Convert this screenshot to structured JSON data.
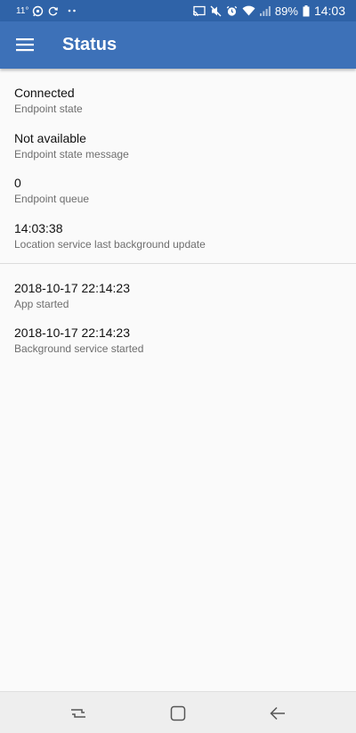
{
  "status_bar": {
    "temperature": "11°",
    "battery_percent": "89%",
    "time": "14:03",
    "icons_left": [
      "whatsapp-icon",
      "sync-icon",
      "more-dots-icon"
    ],
    "icons_right": [
      "cast-icon",
      "mute-icon",
      "alarm-icon",
      "wifi-icon",
      "signal-icon",
      "battery-icon"
    ]
  },
  "app_bar": {
    "title": "Status",
    "menu_icon": "hamburger-menu-icon"
  },
  "status_items": [
    {
      "value": "Connected",
      "label": "Endpoint state"
    },
    {
      "value": "Not available",
      "label": "Endpoint state message"
    },
    {
      "value": "0",
      "label": "Endpoint queue"
    },
    {
      "value": "14:03:38",
      "label": "Location service last background update"
    }
  ],
  "app_items": [
    {
      "value": "2018-10-17 22:14:23",
      "label": "App started"
    },
    {
      "value": "2018-10-17 22:14:23",
      "label": "Background service started"
    }
  ],
  "nav_bar": {
    "buttons": [
      "recents-icon",
      "home-icon",
      "back-icon"
    ]
  },
  "colors": {
    "status_bar": "#2f63a8",
    "app_bar": "#3d71b8",
    "background": "#fafafa",
    "nav_bar": "#eeeeee"
  }
}
